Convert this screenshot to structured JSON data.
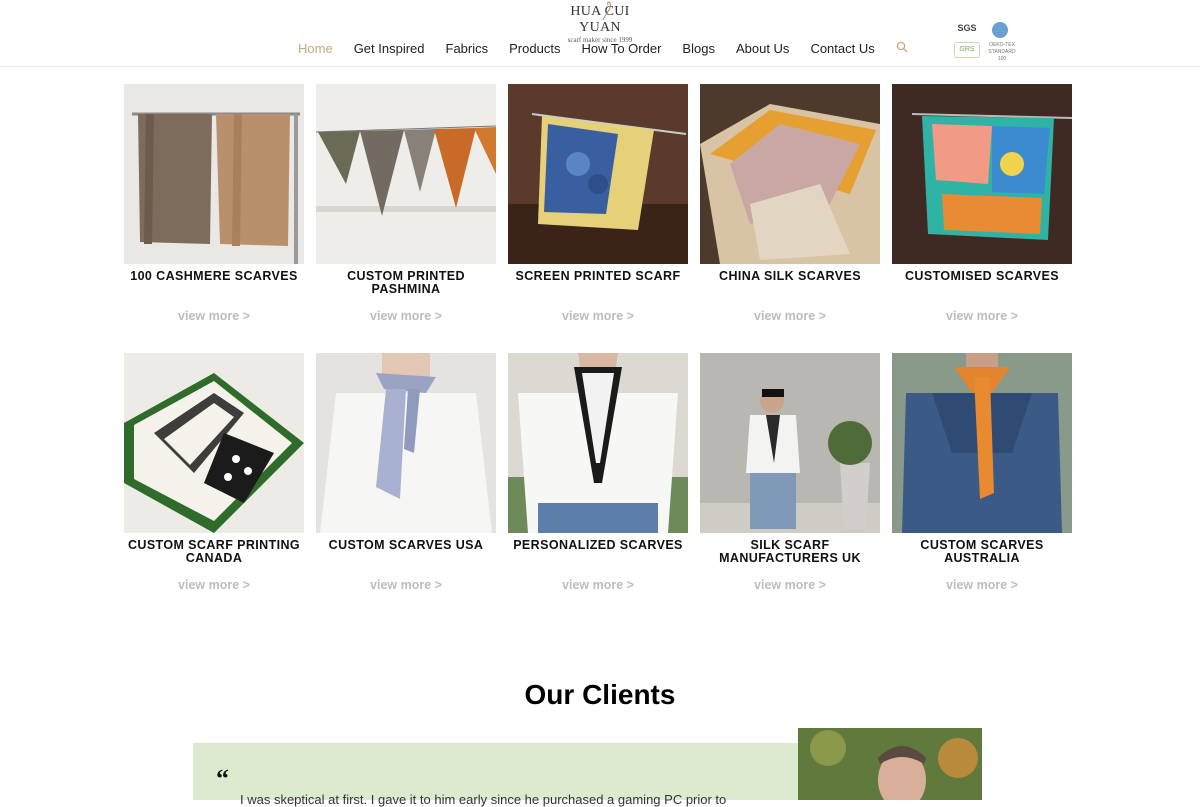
{
  "header": {
    "logo": {
      "name": "HUA CUI YUAN",
      "tagline": "scarf maker since 1999"
    },
    "nav": [
      {
        "label": "Home",
        "active": true
      },
      {
        "label": "Get Inspired"
      },
      {
        "label": "Fabrics"
      },
      {
        "label": "Products"
      },
      {
        "label": "How To Order"
      },
      {
        "label": "Blogs"
      },
      {
        "label": "About Us"
      },
      {
        "label": "Contact Us"
      }
    ],
    "search_icon": "search-icon",
    "badges": {
      "sgs": "SGS",
      "grs": "GRS",
      "oeko": "OEKO-TEX STANDARD 100"
    }
  },
  "products": [
    {
      "title": "100 CASHMERE SCARVES",
      "more": "view more >"
    },
    {
      "title": "CUSTOM PRINTED PASHMINA",
      "more": "view more >"
    },
    {
      "title": "SCREEN PRINTED SCARF",
      "more": "view more >"
    },
    {
      "title": "CHINA SILK SCARVES",
      "more": "view more >"
    },
    {
      "title": "CUSTOMISED SCARVES",
      "more": "view more >"
    },
    {
      "title": "CUSTOM SCARF PRINTING CANADA",
      "more": "view more >"
    },
    {
      "title": "CUSTOM SCARVES USA",
      "more": "view more >"
    },
    {
      "title": "PERSONALIZED SCARVES",
      "more": "view more >"
    },
    {
      "title": "SILK SCARF MANUFACTURERS UK",
      "more": "view more >"
    },
    {
      "title": "CUSTOM SCARVES AUSTRALIA",
      "more": "view more >"
    }
  ],
  "clients": {
    "title": "Our Clients",
    "quote_mark": "“",
    "text": "I was skeptical at first. I gave it to him early since he purchased a gaming PC prior to"
  },
  "colors": {
    "accent": "#c9a77a",
    "testimonial_bg": "#deeacf",
    "muted": "#bdbdbd"
  }
}
